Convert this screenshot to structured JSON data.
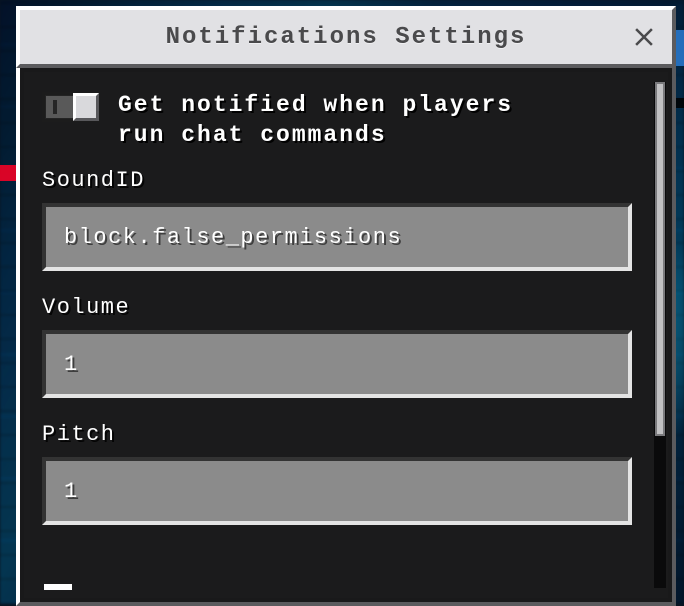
{
  "window": {
    "title": "Notifications Settings"
  },
  "toggle": {
    "label": "Get notified when players\nrun chat commands",
    "on": true
  },
  "fields": {
    "sound_id": {
      "label": "SoundID",
      "value": "block.false_permissions"
    },
    "volume": {
      "label": "Volume",
      "value": "1"
    },
    "pitch": {
      "label": "Pitch",
      "value": "1"
    }
  },
  "colors": {
    "panel_light": "#e1e1e4",
    "panel_dark": "#5b5b5e",
    "input_bg": "#8b8b8b",
    "text": "#ffffff"
  }
}
